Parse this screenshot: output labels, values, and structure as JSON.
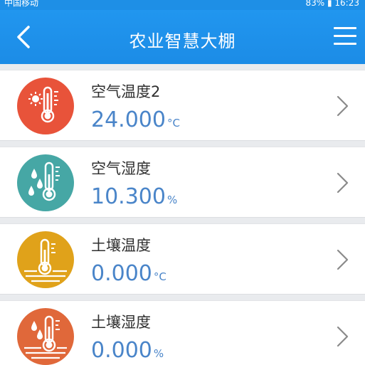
{
  "status_bar": {
    "left_text": "中国移动",
    "right_text": "83%",
    "time": "16:23"
  },
  "header": {
    "title": "农业智慧大棚",
    "back_icon": "chevron-left-icon",
    "menu_icon": "hamburger-menu-icon"
  },
  "sensors": [
    {
      "label": "空气温度2",
      "value": "24.000",
      "unit": "°C",
      "icon": "thermometer-sun-icon",
      "color": "#e8533a"
    },
    {
      "label": "空气湿度",
      "value": "10.300",
      "unit": "%",
      "icon": "thermometer-drops-icon",
      "color": "#46a7a5"
    },
    {
      "label": "土壤温度",
      "value": "0.000",
      "unit": "°C",
      "icon": "thermometer-ground-icon",
      "color": "#e0a21a"
    },
    {
      "label": "土壤湿度",
      "value": "0.000",
      "unit": "%",
      "icon": "thermometer-soil-drops-icon",
      "color": "#e0683a"
    }
  ],
  "colors": {
    "header": "#1e8fe6",
    "value_text": "#4a85c9"
  }
}
